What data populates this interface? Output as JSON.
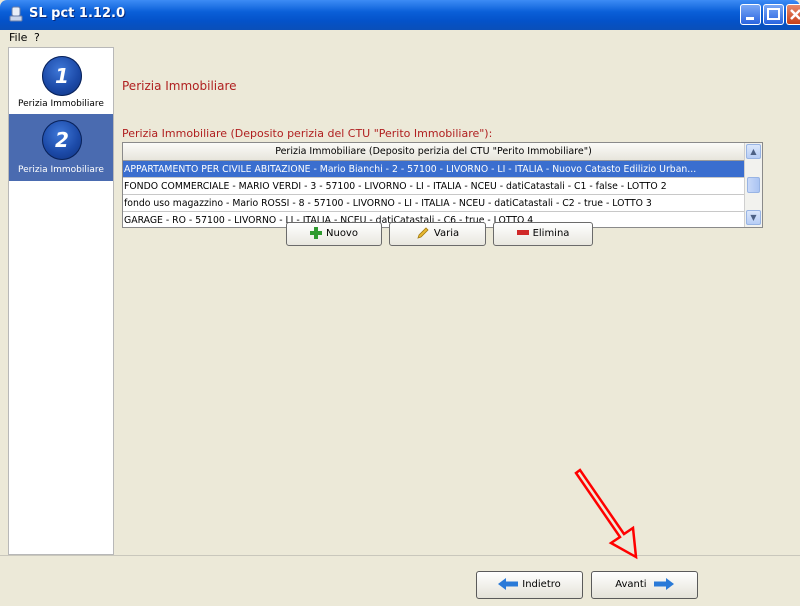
{
  "window": {
    "title": "SL pct 1.12.0"
  },
  "menu": {
    "file": "File",
    "help": "?"
  },
  "sidebar": {
    "steps": [
      {
        "number": "1",
        "label": "Perizia Immobiliare"
      },
      {
        "number": "2",
        "label": "Perizia Immobiliare"
      }
    ]
  },
  "main": {
    "section_title": "Perizia Immobiliare",
    "table_caption": "Perizia Immobiliare (Deposito perizia del CTU \"Perito Immobiliare\"):",
    "table": {
      "header": "Perizia Immobiliare (Deposito perizia del CTU \"Perito Immobiliare\")",
      "rows": [
        "APPARTAMENTO PER CIVILE ABITAZIONE - Mario Bianchi - 2 - 57100 - LIVORNO - LI - ITALIA - Nuovo Catasto Edilizio Urban...",
        "FONDO COMMERCIALE - MARIO VERDI - 3 - 57100 - LIVORNO - LI - ITALIA - NCEU - datiCatastali - C1 - false - LOTTO 2",
        "fondo uso magazzino - Mario ROSSI - 8 - 57100 - LIVORNO - LI - ITALIA - NCEU - datiCatastali - C2 - true - LOTTO 3",
        "GARAGE - RO - 57100 - LIVORNO - LI - ITALIA - NCEU - datiCatastali - C6 - true - LOTTO 4"
      ]
    },
    "buttons": {
      "nuovo": "Nuovo",
      "varia": "Varia",
      "elimina": "Elimina"
    }
  },
  "nav": {
    "back": "Indietro",
    "next": "Avanti"
  },
  "colors": {
    "accent_red": "#b02020",
    "selection": "#3a6ecf",
    "active_step": "#4a6bb0",
    "arrow_blue": "#2a7ad8"
  }
}
